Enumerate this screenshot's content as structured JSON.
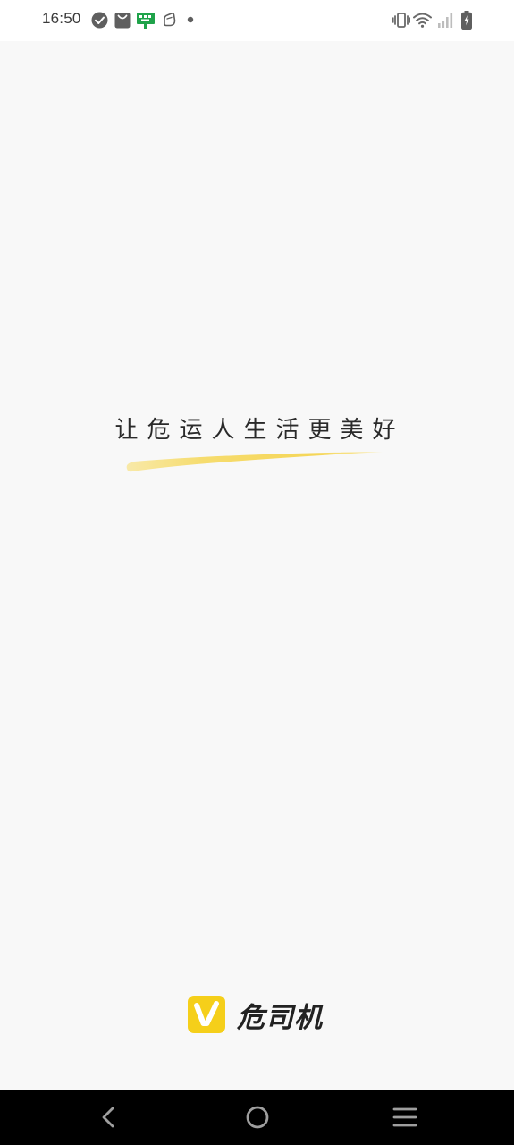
{
  "status_bar": {
    "time": "16:50",
    "left_icons": [
      "check-circle-icon",
      "shopping-bag-icon",
      "app-notification-icon",
      "hand-icon",
      "dot-icon"
    ],
    "right_icons": [
      "vibrate-icon",
      "wifi-icon",
      "signal-icon",
      "battery-charging-icon"
    ]
  },
  "splash": {
    "slogan": "让危运人生活更美好",
    "brand_name": "危司机",
    "logo_letter": "V",
    "accent_color": "#f5cf1a",
    "brush_color": "#f6dc6e"
  },
  "nav_bar": {
    "buttons": [
      "back-icon",
      "home-icon",
      "recents-icon"
    ]
  }
}
